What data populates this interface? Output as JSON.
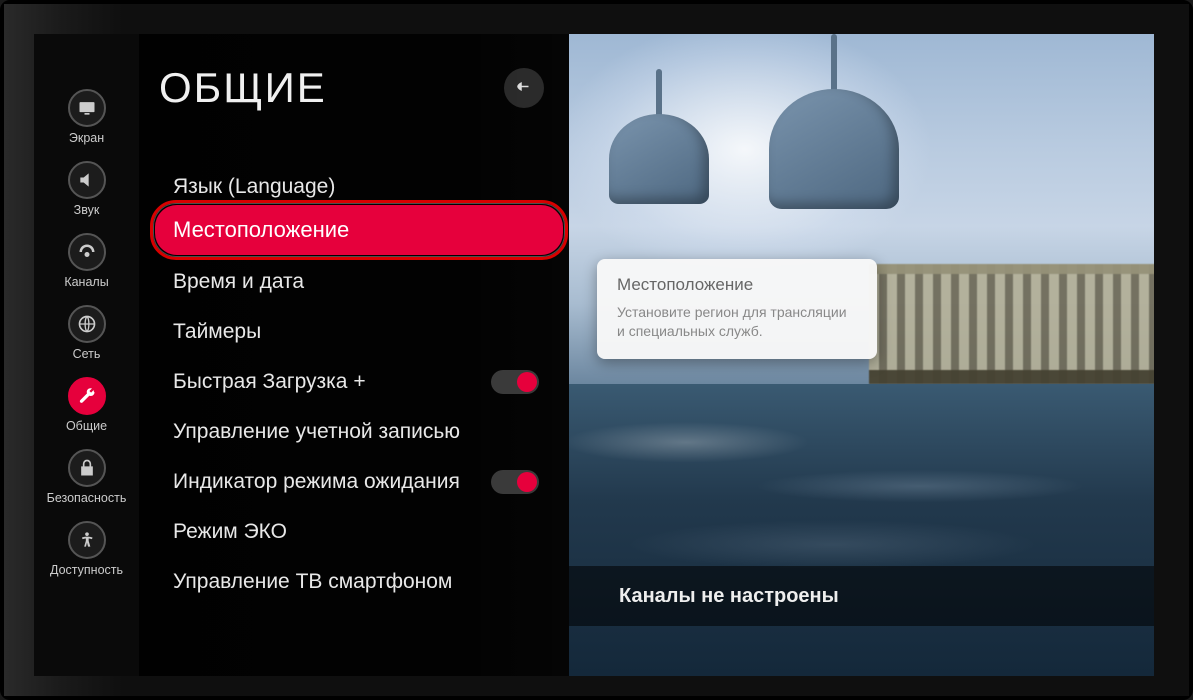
{
  "sidebar": {
    "items": [
      {
        "label": "Экран"
      },
      {
        "label": "Звук"
      },
      {
        "label": "Каналы"
      },
      {
        "label": "Сеть"
      },
      {
        "label": "Общие"
      },
      {
        "label": "Безопасность"
      },
      {
        "label": "Доступность"
      }
    ]
  },
  "panel": {
    "title": "ОБЩИЕ",
    "items": [
      {
        "label": "Язык (Language)"
      },
      {
        "label": "Местоположение",
        "selected": true
      },
      {
        "label": "Время и дата"
      },
      {
        "label": "Таймеры"
      },
      {
        "label": "Быстрая Загрузка +",
        "toggle": true
      },
      {
        "label": "Управление учетной записью"
      },
      {
        "label": "Индикатор режима ожидания",
        "toggle": true
      },
      {
        "label": "Режим ЭКО"
      },
      {
        "label": "Управление ТВ смартфоном"
      }
    ]
  },
  "tooltip": {
    "title": "Местоположение",
    "desc": "Установите регион для трансляции и специальных служб."
  },
  "status": {
    "text": "Каналы не настроены"
  },
  "colors": {
    "accent": "#e6003c"
  }
}
